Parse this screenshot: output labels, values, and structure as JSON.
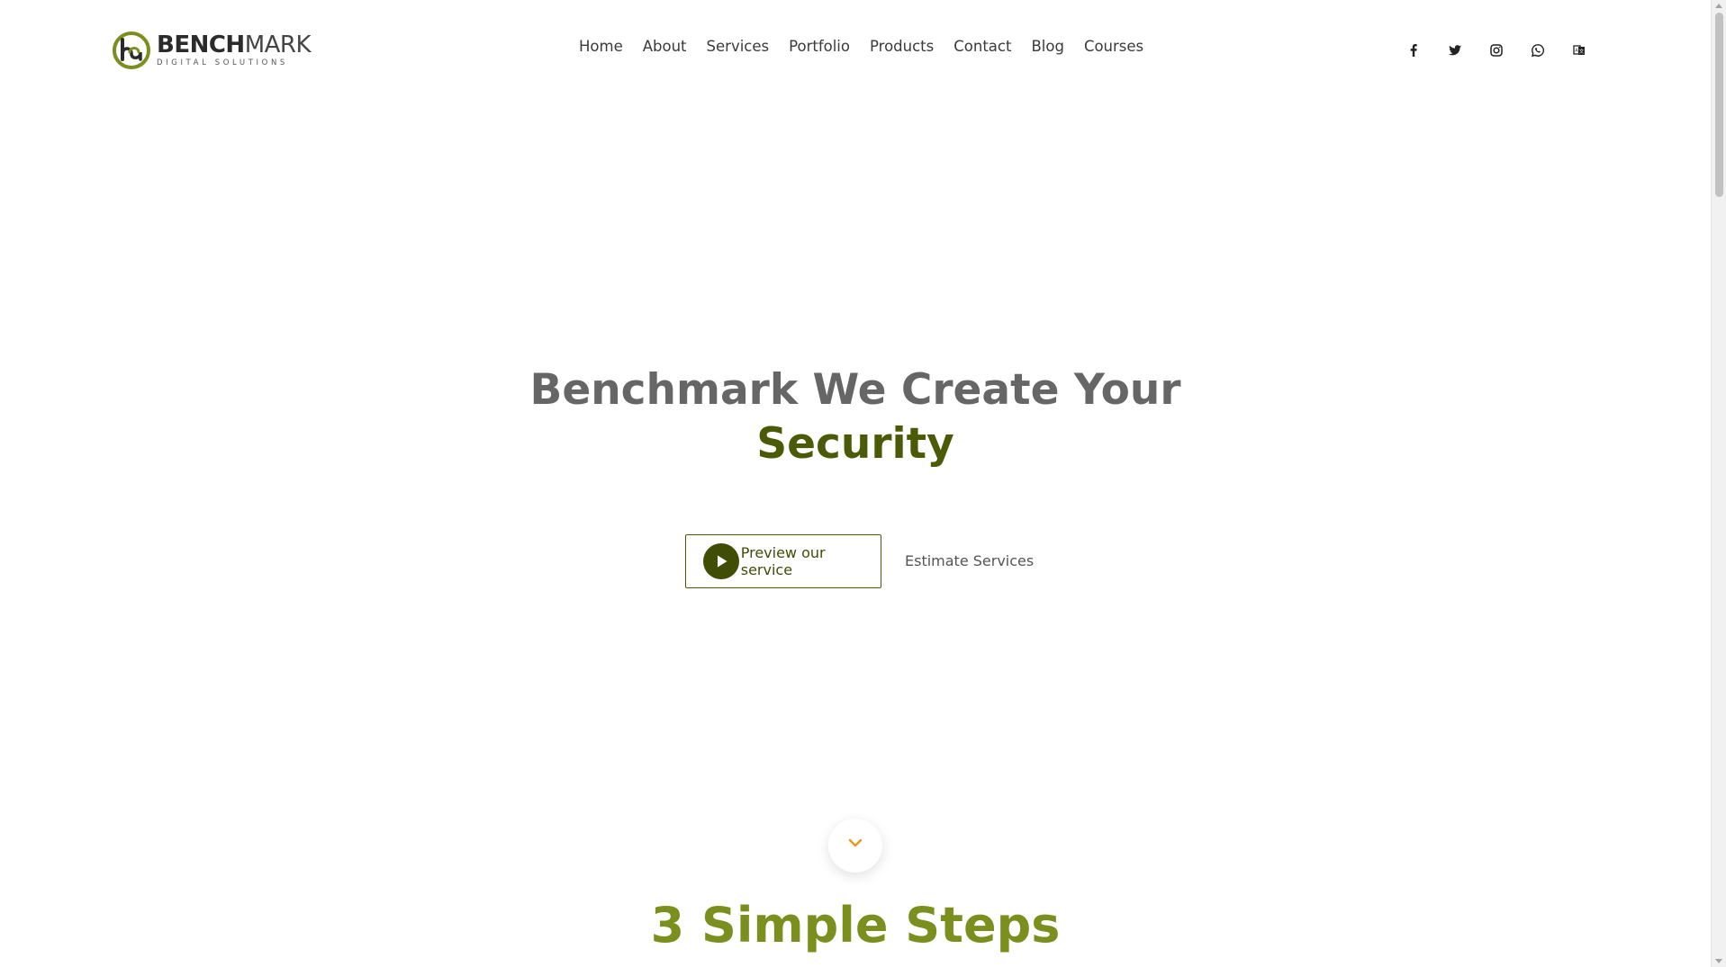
{
  "brand": {
    "name_bold": "BENCH",
    "name_light": "MARK",
    "tagline": "DIGITAL SOLUTIONS",
    "accent_color": "#7a8f1e",
    "dark_accent_color": "#4a5a06"
  },
  "nav": {
    "items": [
      {
        "label": "Home"
      },
      {
        "label": "About"
      },
      {
        "label": "Services"
      },
      {
        "label": "Portfolio"
      },
      {
        "label": "Products"
      },
      {
        "label": "Contact"
      },
      {
        "label": "Blog"
      },
      {
        "label": "Courses"
      }
    ]
  },
  "social": {
    "icons": [
      "facebook-icon",
      "twitter-icon",
      "instagram-icon",
      "whatsapp-icon",
      "translate-icon"
    ]
  },
  "hero": {
    "title_line1": "Benchmark We Create Your",
    "title_accent": "Security",
    "preview_button": "Preview our service",
    "estimate_link": "Estimate Services"
  },
  "steps": {
    "title": "3 Simple Steps"
  }
}
